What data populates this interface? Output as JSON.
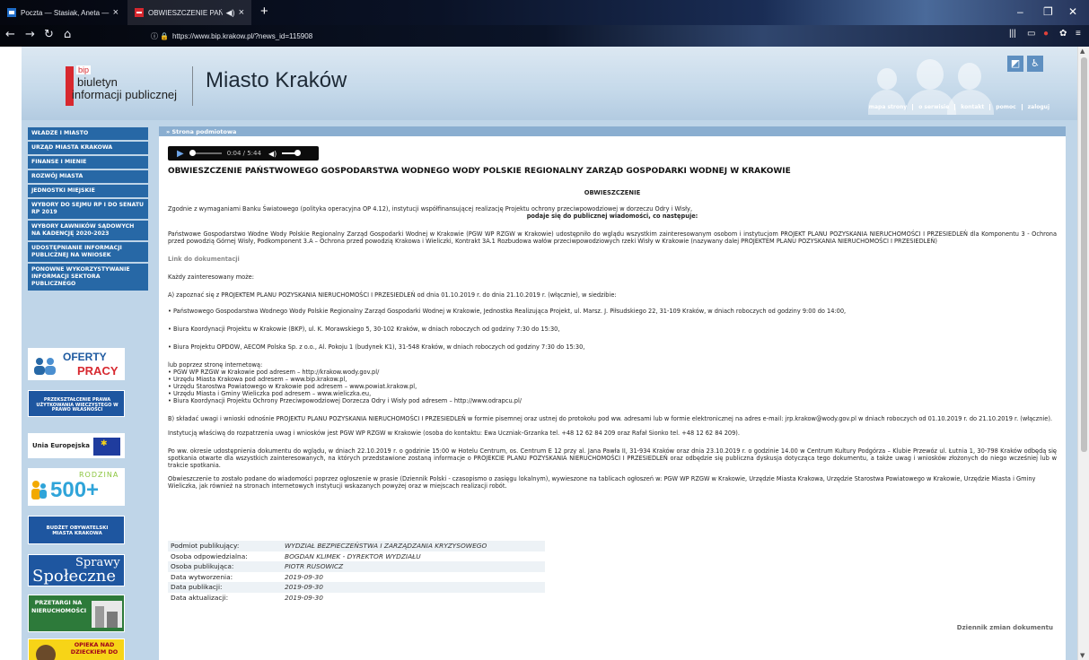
{
  "browser": {
    "tabs": [
      {
        "title": "Poczta — Stasiak, Aneta — Ou"
      },
      {
        "title": "OBWIESZCZENIE PAŃSTW"
      }
    ],
    "url": "https://www.bip.krakow.pl/?news_id=115908"
  },
  "site": {
    "logo_bip": "bip",
    "logo_line1": "biuletyn",
    "logo_line2": "informacji publicznej",
    "city": "Miasto Kraków",
    "toplinks": [
      "mapa strony",
      "o serwisie",
      "kontakt",
      "pomoc",
      "zaloguj"
    ]
  },
  "sidebar": {
    "items": [
      "WŁADZE I MIASTO",
      "URZĄD MIASTA KRAKOWA",
      "FINANSE I MIENIE",
      "ROZWÓJ MIASTA",
      "JEDNOSTKI MIEJSKIE",
      "WYBORY DO SEJMU RP I DO SENATU RP 2019",
      "WYBORY ŁAWNIKÓW SĄDOWYCH NA KADENCJĘ 2020-2023",
      "UDOSTĘPNIANIE INFORMACJI PUBLICZNEJ NA WNIOSEK",
      "PONOWNE WYKORZYSTYWANIE INFORMACJI SEKTORA PUBLICZNEGO"
    ],
    "banners": {
      "oferty_1": "OFERTY",
      "oferty_2": "PRACY",
      "przeksztalcenie": "PRZEKSZTAŁCENIE PRAWA UŻYTKOWANIA WIECZYSTEGO W PRAWO WŁASNOŚCI",
      "ue": "Unia Europejska",
      "rodzina": "RODZINA",
      "r500": "500+",
      "budzet": "BUDŻET OBYWATELSKI MIASTA KRAKOWA",
      "sprawy_1": "Sprawy",
      "sprawy_2": "Społeczne",
      "przetargi": "PRZETARGI NA NIERUCHOMOŚCI",
      "opieka": "OPIEKA NAD DZIECKIEM DO"
    }
  },
  "content": {
    "breadcrumb": "» Strona podmiotowa",
    "player_time": "0:04 / 5:44",
    "title": "OBWIESZCZENIE PAŃSTWOWEGO GOSPODARSTWA WODNEGO WODY POLSKIE REGIONALNY ZARZĄD GOSPODARKI WODNEJ W KRAKOWIE",
    "subtitle": "OBWIESZCZENIE",
    "p1": "Zgodnie z wymaganiami Banku Światowego (polityka operacyjna OP 4.12), instytucji współfinansującej realizację Projektu ochrony przeciwpowodziowej w dorzeczu Odry i Wisły,",
    "p1b": "podaje się do publicznej wiadomości, co następuje:",
    "p2": "Państwowe Gospodarstwo Wodne Wody Polskie Regionalny Zarząd Gospodarki Wodnej w Krakowie (PGW WP RZGW w Krakowie) udostępniło do wglądu wszystkim zainteresowanym osobom i instytucjom PROJEKT PLANU POZYSKANIA NIERUCHOMOŚCI I PRZESIEDLEŃ dla Komponentu 3 - Ochrona przed powodzią Górnej Wisły, Podkomponent 3.A – Ochrona przed powodzią Krakowa i Wieliczki, Kontrakt 3A.1 Rozbudowa wałów przeciwpowodziowych rzeki Wisły w Krakowie (nazywany dalej PROJEKTEM PLANU POZYSKANIA NIERUCHOMOŚCI I PRZESIEDLEŃ)",
    "link_doc": "Link do dokumentacji",
    "p3": "Każdy zainteresowany może:",
    "p4": "A) zapoznać się z PROJEKTEM PLANU POZYSKANIA NIERUCHOMOŚCI I PRZESIEDLEŃ od dnia 01.10.2019 r. do dnia 21.10.2019 r. (włącznie), w siedzibie:",
    "b1": "• Państwowego Gospodarstwa Wodnego Wody Polskie Regionalny Zarząd Gospodarki Wodnej w Krakowie, Jednostka Realizująca Projekt, ul. Marsz. J. Piłsudskiego 22, 31-109 Kraków, w dniach roboczych od godziny 9:00 do 14:00,",
    "b2": "• Biura Koordynacji Projektu w Krakowie (BKP), ul. K. Morawskiego 5, 30-102 Kraków, w dniach roboczych od godziny 7:30 do 15:30,",
    "b3": "• Biura Projektu OPDOW, AECOM Polska Sp. z o.o., Al. Pokoju 1 (budynek K1), 31-548 Kraków, w dniach roboczych od godziny 7:30 do 15:30,",
    "lp0": "lub poprzez stronę internetową:",
    "lp1": "• PGW WP RZGW w Krakowie pod adresem – http://krakow.wody.gov.pl/",
    "lp2": "• Urzędu Miasta Krakowa pod adresem – www.bip.krakow.pl,",
    "lp3": "• Urzędu Starostwa Powiatowego w Krakowie pod adresem – www.powiat.krakow.pl,",
    "lp4": "• Urzędu Miasta i Gminy Wieliczka pod adresem – www.wieliczka.eu,",
    "lp5": "• Biura Koordynacji Projektu Ochrony Przeciwpowodziowej Dorzecza Odry i Wisły pod adresem – http://www.odrapcu.pl/",
    "p5": "B) składać uwagi i wnioski odnośnie PROJEKTU PLANU POZYSKANIA NIERUCHOMOŚCI I PRZESIEDLEŃ w formie pisemnej oraz ustnej do protokołu pod ww. adresami lub w formie elektronicznej na adres e-mail: jrp.krakow@wody.gov.pl w dniach roboczych od 01.10.2019 r. do 21.10.2019 r. (włącznie).",
    "p5b": "Instytucją właściwą do rozpatrzenia uwag i wniosków jest PGW WP RZGW w Krakowie (osoba do kontaktu: Ewa Uczniak-Grzanka tel. +48 12 62 84 209 oraz Rafał Sionko tel. +48 12 62 84 209).",
    "p6": "Po ww. okresie udostępnienia dokumentu do wglądu, w dniach 22.10.2019 r. o godzinie 15:00 w Hotelu Centrum, os. Centrum E 12 przy al. Jana Pawła II, 31-934 Kraków oraz dnia 23.10.2019 r. o godzinie 14.00 w Centrum Kultury Podgórza – Klubie Przewóz ul. Łutnia 1, 30-798 Kraków odbędą się spotkania otwarte dla wszystkich zainteresowanych, na których przedstawione zostaną informacje o PROJEKCIE PLANU POZYSKANIA NIERUCHOMOŚCI I PRZESIEDLEŃ oraz odbędzie się publiczna dyskusja dotycząca tego dokumentu, a także uwag i wniosków złożonych do niego wcześniej lub w trakcie spotkania.",
    "p7": "Obwieszczenie to zostało podane do wiadomości poprzez ogłoszenie w prasie (Dziennik Polski - czasopismo o zasięgu lokalnym), wywieszone na tablicach ogłoszeń w: PGW WP RZGW w Krakowie, Urzędzie Miasta Krakowa, Urzędzie Starostwa Powiatowego w Krakowie, Urzędzie Miasta i Gminy Wieliczka, jak również na stronach internetowych instytucji wskazanych powyżej oraz w miejscach realizacji robót.",
    "meta": [
      {
        "k": "Podmiot publikujący:",
        "v": "WYDZIAŁ BEZPIECZEŃSTWA I ZARZĄDZANIA KRYZYSOWEGO"
      },
      {
        "k": "Osoba odpowiedzialna:",
        "v": "BOGDAN KLIMEK - DYREKTOR WYDZIAŁU"
      },
      {
        "k": "Osoba publikująca:",
        "v": "PIOTR RUSOWICZ"
      },
      {
        "k": "Data wytworzenia:",
        "v": "2019-09-30"
      },
      {
        "k": "Data publikacji:",
        "v": "2019-09-30"
      },
      {
        "k": "Data aktualizacji:",
        "v": "2019-09-30"
      }
    ],
    "dziennik": "Dziennik zmian dokumentu"
  }
}
